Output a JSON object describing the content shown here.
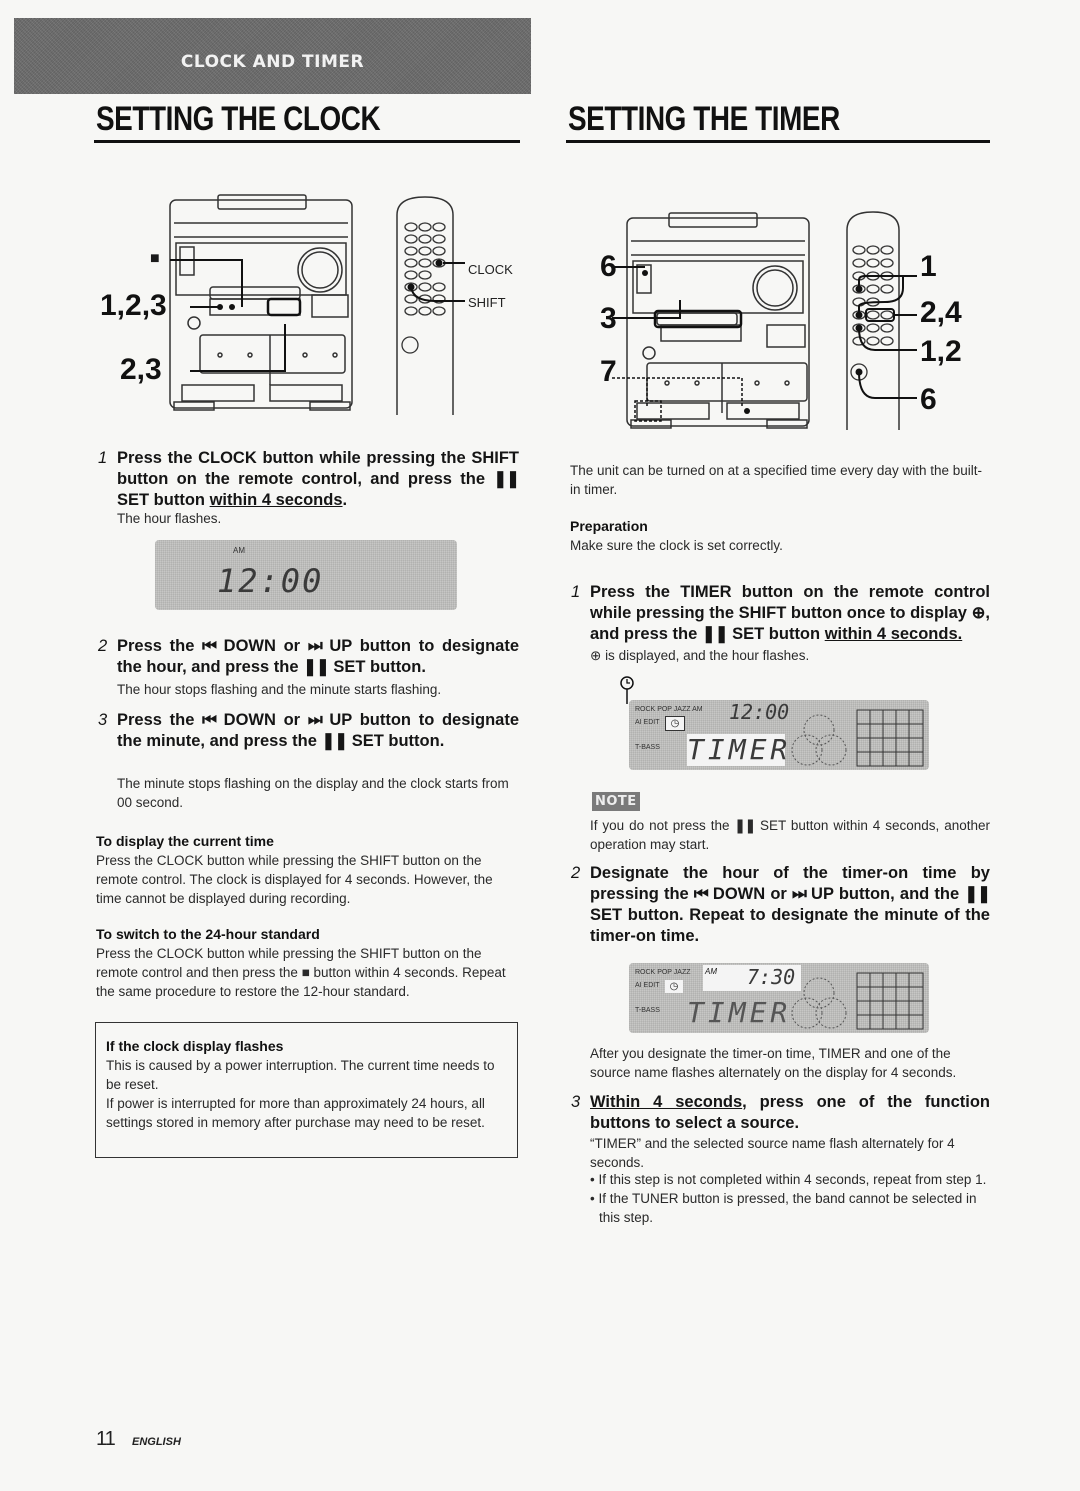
{
  "banner": {
    "title": "CLOCK AND TIMER"
  },
  "clock": {
    "heading": "SETTING THE CLOCK",
    "diagram": {
      "callouts": [
        "■",
        "1,2,3",
        "2,3"
      ],
      "remote_labels": [
        "CLOCK",
        "SHIFT"
      ]
    },
    "steps": [
      {
        "num": "1",
        "text_before": "Press the CLOCK button while pressing the SHIFT button on the remote control, and press the ",
        "set_glyph": "❚❚",
        "text_mid": " SET button ",
        "underlined": "within 4 seconds",
        "text_after": ".",
        "note": "The hour flashes."
      },
      {
        "num": "2",
        "line1_a": "Press the ",
        "down_glyph": "⏮",
        "line1_b": " DOWN or ",
        "up_glyph": "⏭",
        "line1_c": " UP button to designate the hour, and press the ",
        "set_glyph": "❚❚",
        "line1_d": " SET button.",
        "note": "The hour stops flashing and  the minute starts flashing."
      },
      {
        "num": "3",
        "line1_a": "Press the ",
        "down_glyph": "⏮",
        "line1_b": " DOWN or ",
        "up_glyph": "⏭",
        "line1_c": " UP button to designate the minute, and press the ",
        "set_glyph": "❚❚",
        "line1_d": " SET button.",
        "note": "The minute stops flashing on the display and the clock starts from 00 second."
      }
    ],
    "lcd1": {
      "am": "AM",
      "time": "12:00"
    },
    "display_current": {
      "title": "To display the current time",
      "text": "Press the CLOCK button while pressing the SHIFT button on the remote control.  The clock is displayed for 4 seconds. However, the time cannot be displayed during recording."
    },
    "switch_24": {
      "title": "To switch to the 24-hour standard",
      "text_a": "Press the CLOCK button while pressing the SHIFT button on the remote control and then press the ",
      "stop_glyph": "■",
      "text_b": " button within 4 seconds. Repeat the same procedure to restore the 12-hour standard."
    },
    "flash_box": {
      "title": "If the clock display flashes",
      "p1": "This is caused by a power interruption. The current time needs to be reset.",
      "p2": "If power is interrupted for more than approximately 24 hours, all settings stored in memory after purchase may need to be reset."
    }
  },
  "timer": {
    "heading": "SETTING THE TIMER",
    "diagram": {
      "callouts_left": [
        "6",
        "3",
        "7"
      ],
      "callouts_right": [
        "1",
        "2,4",
        "1,2",
        "6"
      ]
    },
    "intro": "The unit can be turned on at a specified time every day with the built-in timer.",
    "preparation": {
      "title": "Preparation",
      "text": "Make sure the clock is set correctly."
    },
    "step1": {
      "num": "1",
      "a": "Press the TIMER button on the remote control while pressing the SHIFT button once to display ",
      "clock_glyph": "⊕",
      "b": ", and press the ",
      "set_glyph": "❚❚",
      "c": " SET button ",
      "underlined": "within 4 seconds.",
      "note": "is displayed, and the hour flashes."
    },
    "lcd2": {
      "modes": [
        "ROCK",
        "POP",
        "JAZZ"
      ],
      "am": "AM",
      "time": "12:00",
      "ai_edit": "AI EDIT",
      "tbass": "T-BASS",
      "main": "TIMER"
    },
    "note": {
      "badge": "NOTE",
      "text_a": "If you do not press the ",
      "set_glyph": "❚❚",
      "text_b": " SET button within 4 seconds, another operation may start."
    },
    "step2": {
      "num": "2",
      "a": "Designate the hour of the timer-on time by pressing the ",
      "down_glyph": "⏮",
      "b": " DOWN or ",
      "up_glyph": "⏭",
      "c": " UP button, and the ",
      "set_glyph": "❚❚",
      "d": " SET button. Repeat to designate the minute of the timer-on time.",
      "note": "After you designate the timer-on time, TIMER and one of the source name flashes alternately on the display for 4 seconds."
    },
    "lcd3": {
      "modes": [
        "ROCK",
        "POP",
        "JAZZ"
      ],
      "am": "AM",
      "time": "7:30",
      "ai_edit": "AI EDIT",
      "tbass": "T-BASS",
      "main": "TIMER"
    },
    "step3": {
      "num": "3",
      "underlined": "Within 4 seconds",
      "a": ", press one of the function buttons to select a source.",
      "note": "“TIMER” and the selected source name flash alternately for 4 seconds.",
      "bullets": [
        "If this step is not completed within 4 seconds, repeat from step 1.",
        "If the TUNER button is pressed, the band cannot be selected in this step."
      ]
    }
  },
  "footer": {
    "page": "11",
    "language": "ENGLISH"
  }
}
